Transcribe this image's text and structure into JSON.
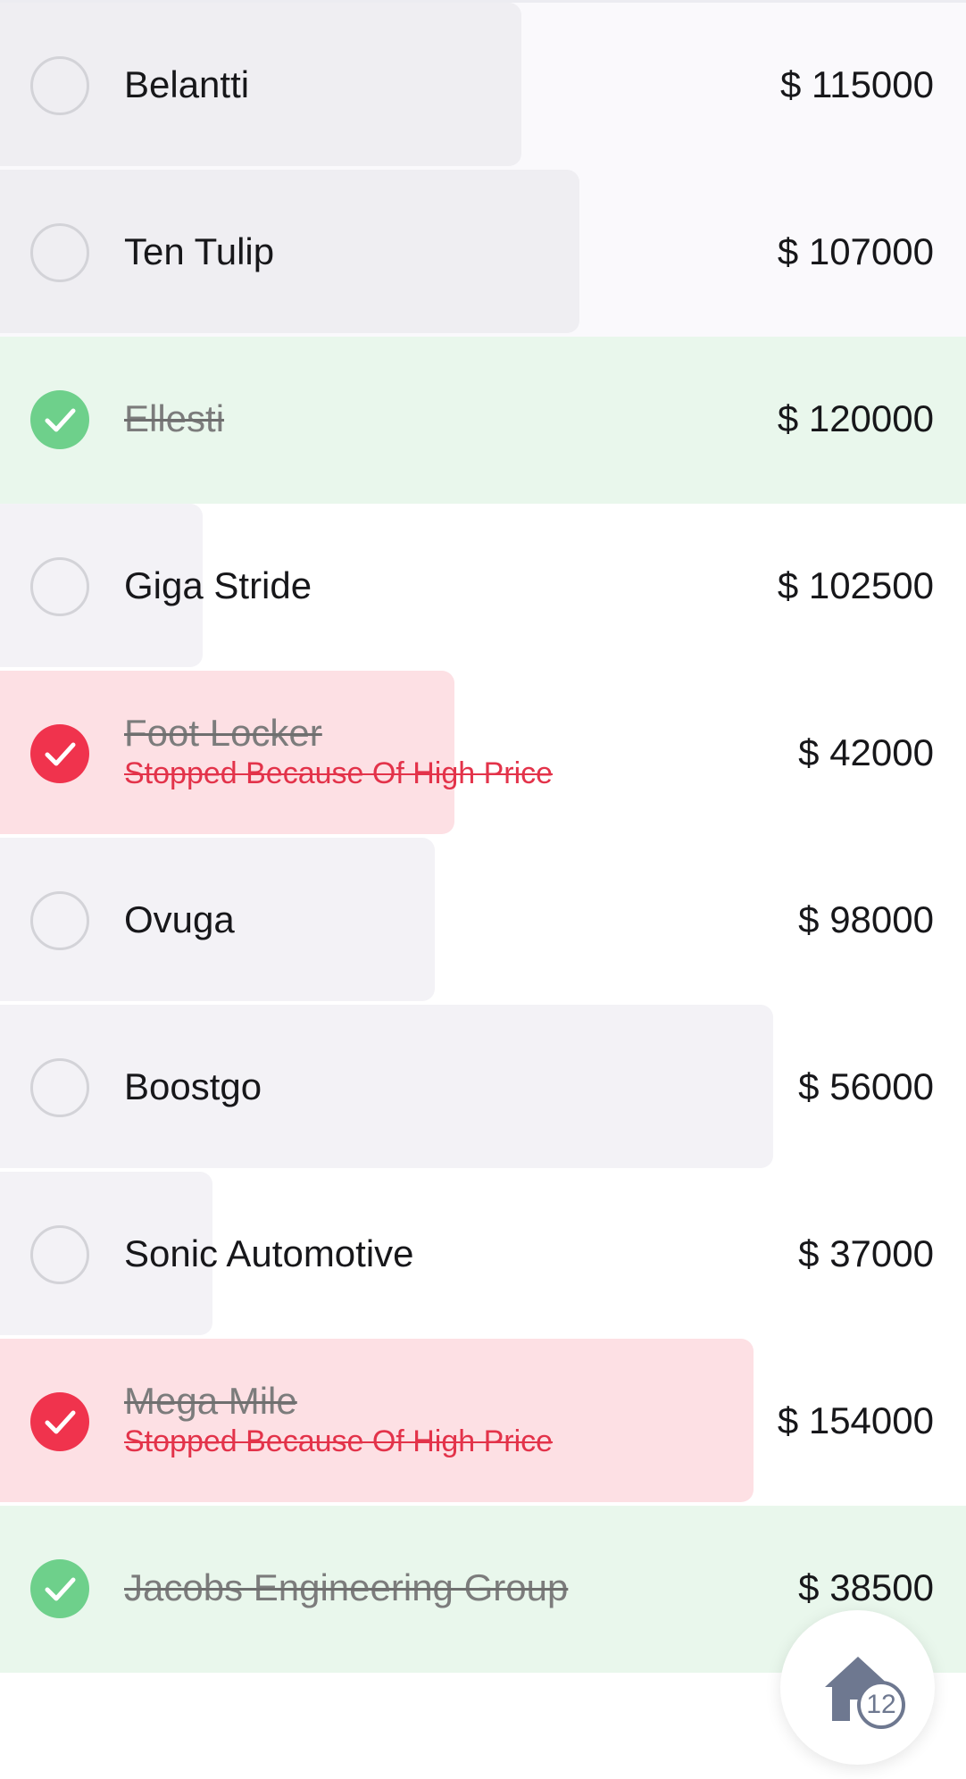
{
  "items": [
    {
      "name": "Belantti",
      "price": "$ 115000",
      "status": "pending",
      "reason": "",
      "progress": 0.54,
      "row_bg": "#faf9fc",
      "bar_color": "#efeef2"
    },
    {
      "name": "Ten Tulip",
      "price": "$ 107000",
      "status": "pending",
      "reason": "",
      "progress": 0.6,
      "row_bg": "#faf9fc",
      "bar_color": "#efeef2"
    },
    {
      "name": "Ellesti",
      "price": "$ 120000",
      "status": "done",
      "reason": "",
      "progress": 0,
      "row_bg": "#e9f7ec",
      "bar_color": ""
    },
    {
      "name": "Giga Stride",
      "price": "$ 102500",
      "status": "pending",
      "reason": "",
      "progress": 0.21,
      "row_bg": "#ffffff",
      "bar_color": "#f3f2f6"
    },
    {
      "name": "Foot Locker",
      "price": "$ 42000",
      "status": "stopped",
      "reason": "Stopped Because Of High Price",
      "progress": 0.47,
      "row_bg": "#ffffff",
      "bar_color": "#fde0e4"
    },
    {
      "name": "Ovuga",
      "price": "$ 98000",
      "status": "pending",
      "reason": "",
      "progress": 0.45,
      "row_bg": "#ffffff",
      "bar_color": "#f3f2f6"
    },
    {
      "name": "Boostgo",
      "price": "$ 56000",
      "status": "pending",
      "reason": "",
      "progress": 0.8,
      "row_bg": "#ffffff",
      "bar_color": "#f3f2f6"
    },
    {
      "name": "Sonic Automotive",
      "price": "$ 37000",
      "status": "pending",
      "reason": "",
      "progress": 0.22,
      "row_bg": "#ffffff",
      "bar_color": "#f3f2f6"
    },
    {
      "name": "Mega Mile",
      "price": "$ 154000",
      "status": "stopped",
      "reason": "Stopped Because Of High Price",
      "progress": 0.78,
      "row_bg": "#ffffff",
      "bar_color": "#fde0e4"
    },
    {
      "name": "Jacobs Engineering Group",
      "price": "$ 38500",
      "status": "done",
      "reason": "",
      "progress": 0,
      "row_bg": "#e9f7ec",
      "bar_color": ""
    }
  ],
  "home_button": {
    "icon": "home-icon",
    "badge": "12",
    "icon_color": "#6e7890"
  },
  "colors": {
    "done": "#6ed08b",
    "stopped": "#f0334d",
    "empty_ring": "#d3d3d8",
    "reason_text": "#e3334a"
  }
}
